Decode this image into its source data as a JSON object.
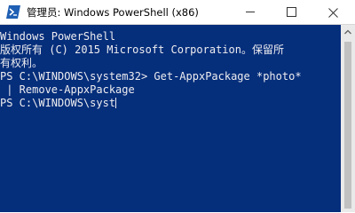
{
  "window": {
    "title": "管理员: Windows PowerShell (x86)",
    "icons": {
      "app": "powershell-icon",
      "minimize": "minimize-icon",
      "maximize": "maximize-icon",
      "close": "close-icon"
    },
    "colors": {
      "console_background": "#052e7b",
      "console_text": "#eeedf0",
      "titlebar_background": "#ffffff"
    }
  },
  "console": {
    "lines": [
      "Windows PowerShell",
      "版权所有 (C) 2015 Microsoft Corporation。保留所",
      "有权利。",
      "",
      "PS C:\\WINDOWS\\system32> Get-AppxPackage *photo*",
      " | Remove-AppxPackage",
      "PS C:\\WINDOWS\\syst"
    ]
  }
}
